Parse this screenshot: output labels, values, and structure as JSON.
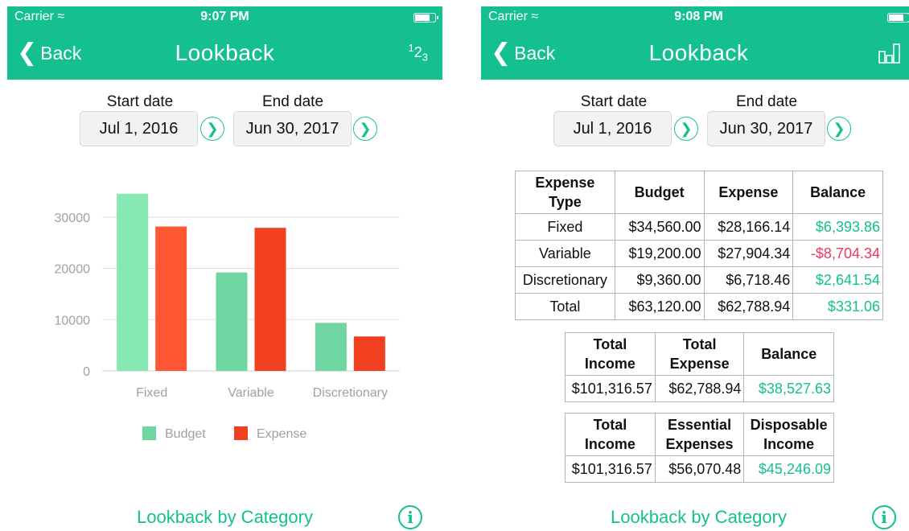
{
  "left": {
    "status": {
      "carrier": "Carrier",
      "time": "9:07 PM"
    },
    "nav": {
      "back": "Back",
      "title": "Lookback",
      "right_icon": "123-numbers-icon"
    },
    "dates": {
      "start_label": "Start date",
      "start_value": "Jul 1, 2016",
      "end_label": "End date",
      "end_value": "Jun 30, 2017"
    },
    "footer_link": "Lookback by Category"
  },
  "right": {
    "status": {
      "carrier": "Carrier",
      "time": "9:08 PM"
    },
    "nav": {
      "back": "Back",
      "title": "Lookback",
      "right_icon": "bar-chart-icon"
    },
    "dates": {
      "start_label": "Start date",
      "start_value": "Jul 1, 2016",
      "end_label": "End date",
      "end_value": "Jun 30, 2017"
    },
    "footer_link": "Lookback by Category",
    "expense_table": {
      "headers": [
        "Expense Type",
        "Budget",
        "Expense",
        "Balance"
      ],
      "rows": [
        {
          "type": "Fixed",
          "budget": "$34,560.00",
          "expense": "$28,166.14",
          "balance": "$6,393.86",
          "status": "pos"
        },
        {
          "type": "Variable",
          "budget": "$19,200.00",
          "expense": "$27,904.34",
          "balance": "-$8,704.34",
          "status": "neg"
        },
        {
          "type": "Discretionary",
          "budget": "$9,360.00",
          "expense": "$6,718.46",
          "balance": "$2,641.54",
          "status": "pos"
        },
        {
          "type": "Total",
          "budget": "$63,120.00",
          "expense": "$62,788.94",
          "balance": "$331.06",
          "status": "pos"
        }
      ]
    },
    "income_table": {
      "headers": [
        "Total Income",
        "Total Expense",
        "Balance"
      ],
      "values": [
        "$101,316.57",
        "$62,788.94",
        "$38,527.63"
      ]
    },
    "disposable_table": {
      "headers": [
        "Total Income",
        "Essential Expenses",
        "Disposable Income"
      ],
      "values": [
        "$101,316.57",
        "$56,070.48",
        "$45,246.09"
      ]
    }
  },
  "colors": {
    "accent": "#14c08f",
    "budget": "#6fd6a2",
    "budget_highlight": "#86e9b4",
    "expense": "#f0401f",
    "expense_highlight": "#ff5733",
    "negative": "#f0365f"
  },
  "chart_data": {
    "type": "bar",
    "categories": [
      "Fixed",
      "Variable",
      "Discretionary"
    ],
    "series": [
      {
        "name": "Budget",
        "values": [
          34560,
          19200,
          9360
        ]
      },
      {
        "name": "Expense",
        "values": [
          28166.14,
          27904.34,
          6718.46
        ]
      }
    ],
    "yticks": [
      0,
      10000,
      20000,
      30000
    ],
    "ylim": [
      0,
      35000
    ],
    "grid": true,
    "legend": "bottom"
  }
}
